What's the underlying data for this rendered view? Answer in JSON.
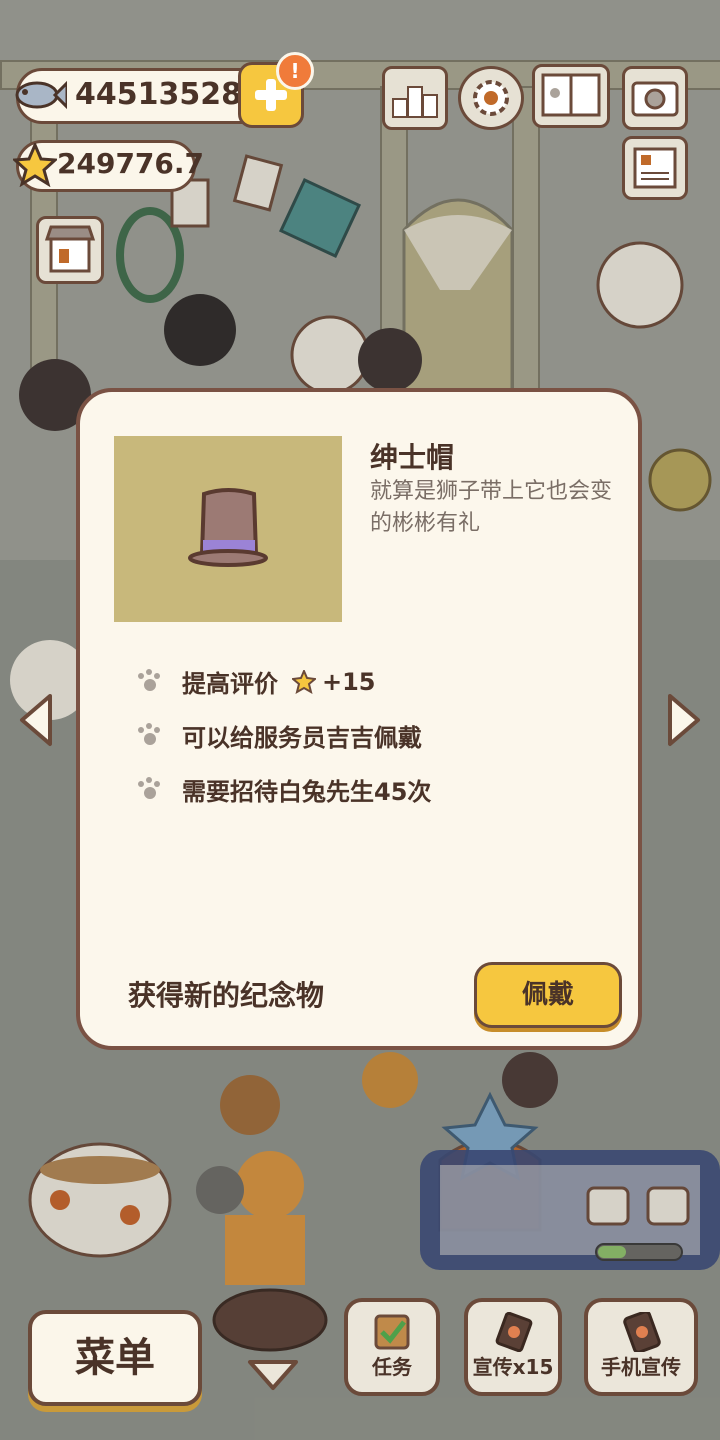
{
  "hud": {
    "fish_count": "445135284",
    "star_rating": "249776.7",
    "alert_badge": "!",
    "icons": [
      "leaderboard-icon",
      "settings-gear-icon",
      "paw-book-icon",
      "camera-icon",
      "newspaper-icon",
      "shop-icon"
    ]
  },
  "modal": {
    "item_name": "绅士帽",
    "item_desc": "就算是狮子带上它也会变的彬彬有礼",
    "bullets": [
      {
        "text": "提高评价",
        "bonus": "+15"
      },
      {
        "text": "可以给服务员吉吉佩戴"
      },
      {
        "text": "需要招待白兔先生45次"
      }
    ],
    "footer_text": "获得新的纪念物",
    "wear_button": "佩戴"
  },
  "bottom_bar": {
    "menu_button": "菜单",
    "task_button": "任务",
    "promo_button": "宣传x15",
    "phone_promo_button": "手机宣传"
  },
  "colors": {
    "accent_yellow": "#f6c73f",
    "brown_border": "#6b4a3a",
    "modal_bg": "#fcf7ec",
    "hat_bg": "#c8b87b",
    "hat_band": "#9b83d6"
  }
}
